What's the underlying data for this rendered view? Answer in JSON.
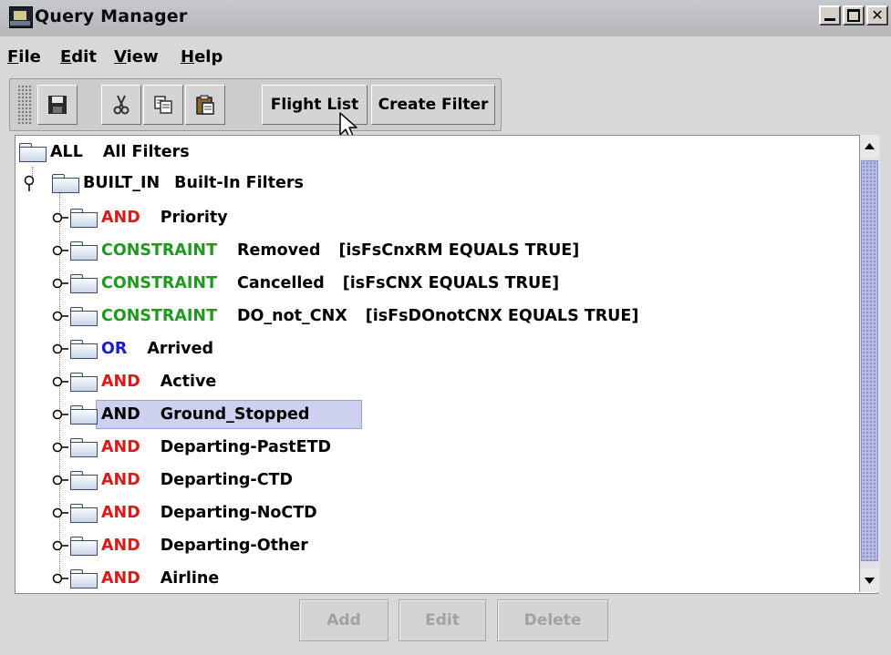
{
  "window": {
    "title": "Query Manager",
    "controls": [
      "minimize-icon",
      "maximize-icon",
      "close-icon"
    ]
  },
  "menubar": {
    "items": [
      {
        "label": "File",
        "mnemonic": "F",
        "rest": "ile"
      },
      {
        "label": "Edit",
        "mnemonic": "E",
        "rest": "dit"
      },
      {
        "label": "View",
        "mnemonic": "V",
        "rest": "iew"
      },
      {
        "label": "Help",
        "mnemonic": "H",
        "rest": "elp"
      }
    ]
  },
  "toolbar": {
    "icon_buttons": [
      "save-icon",
      "cut-icon",
      "copy-icon",
      "paste-icon"
    ],
    "flight_list_label": "Flight List",
    "create_filter_label": "Create Filter"
  },
  "tree": {
    "root": {
      "keyword": "ALL",
      "label": "All Filters"
    },
    "builtin": {
      "keyword": "BUILT_IN",
      "label": "Built-In Filters"
    },
    "children": [
      {
        "keyword": "AND",
        "keyword_color": "#e01818",
        "label": "Priority"
      },
      {
        "keyword": "CONSTRAINT",
        "keyword_color": "#1e9a1e",
        "label": "Removed",
        "expr": "[isFsCnxRM EQUALS TRUE]"
      },
      {
        "keyword": "CONSTRAINT",
        "keyword_color": "#1e9a1e",
        "label": "Cancelled",
        "expr": "[isFsCNX EQUALS TRUE]"
      },
      {
        "keyword": "CONSTRAINT",
        "keyword_color": "#1e9a1e",
        "label": "DO_not_CNX",
        "expr": "[isFsDOnotCNX EQUALS TRUE]"
      },
      {
        "keyword": "OR",
        "keyword_color": "#1a1ad8",
        "label": "Arrived"
      },
      {
        "keyword": "AND",
        "keyword_color": "#e01818",
        "label": "Active"
      },
      {
        "keyword": "AND",
        "keyword_color": "#000000",
        "label": "Ground_Stopped",
        "selected": true
      },
      {
        "keyword": "AND",
        "keyword_color": "#e01818",
        "label": "Departing-PastETD"
      },
      {
        "keyword": "AND",
        "keyword_color": "#e01818",
        "label": "Departing-CTD"
      },
      {
        "keyword": "AND",
        "keyword_color": "#e01818",
        "label": "Departing-NoCTD"
      },
      {
        "keyword": "AND",
        "keyword_color": "#e01818",
        "label": "Departing-Other"
      },
      {
        "keyword": "AND",
        "keyword_color": "#e01818",
        "label": "Airline"
      }
    ]
  },
  "actions": {
    "add_label": "Add",
    "edit_label": "Edit",
    "delete_label": "Delete"
  }
}
